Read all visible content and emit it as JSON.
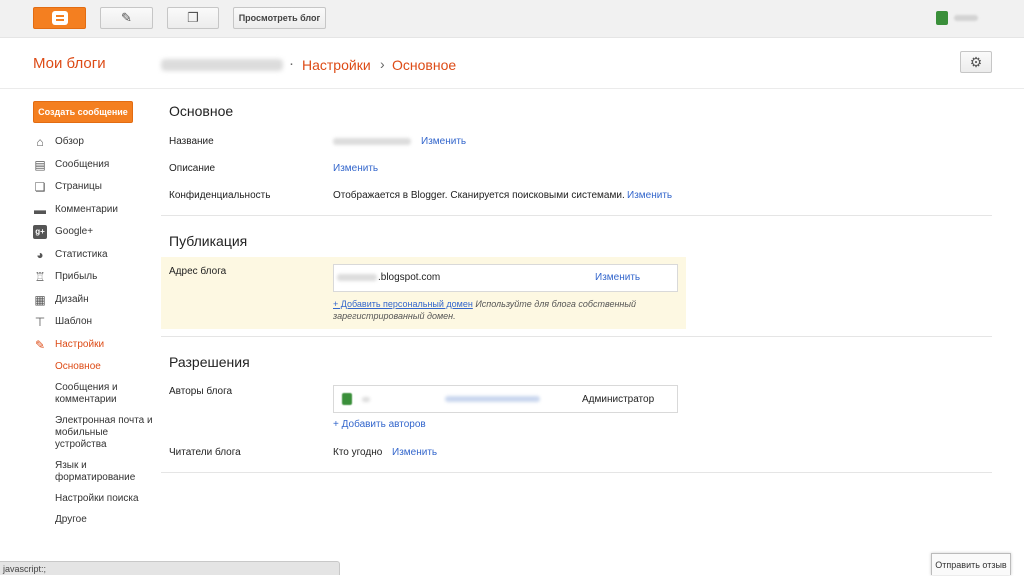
{
  "topbar": {
    "blogger_icon": "blogger-logo-icon",
    "edit_icon": "pencil-icon",
    "posts_icon": "posts-list-icon",
    "view_blog_label": "Просмотреть блог"
  },
  "header": {
    "my_blogs": "Мои блоги",
    "breadcrumb_sep_dot": "·",
    "breadcrumb_settings": "Настройки",
    "breadcrumb_arrow": "›",
    "breadcrumb_current": "Основное",
    "gear_icon": "gear-icon"
  },
  "sidebar": {
    "create_post": "Создать сообщение",
    "items": [
      {
        "label": "Обзор",
        "icon": "home-icon"
      },
      {
        "label": "Сообщения",
        "icon": "posts-icon"
      },
      {
        "label": "Страницы",
        "icon": "pages-icon"
      },
      {
        "label": "Комментарии",
        "icon": "comment-icon"
      },
      {
        "label": "Google+",
        "icon": "google-plus-icon"
      },
      {
        "label": "Статистика",
        "icon": "pie-chart-icon"
      },
      {
        "label": "Прибыль",
        "icon": "trophy-icon"
      },
      {
        "label": "Дизайн",
        "icon": "layout-icon"
      },
      {
        "label": "Шаблон",
        "icon": "paint-roller-icon"
      },
      {
        "label": "Настройки",
        "icon": "wrench-icon"
      }
    ],
    "subitems": [
      {
        "label": "Основное"
      },
      {
        "label": "Сообщения и комментарии"
      },
      {
        "label": "Электронная почта и мобильные устройства"
      },
      {
        "label": "Язык и форматирование"
      },
      {
        "label": "Настройки поиска"
      },
      {
        "label": "Другое"
      }
    ]
  },
  "main": {
    "basic": {
      "title": "Основное",
      "name_label": "Название",
      "name_change": "Изменить",
      "description_label": "Описание",
      "description_change": "Изменить",
      "privacy_label": "Конфиденциальность",
      "privacy_value": "Отображается в Blogger. Сканируется поисковыми системами.",
      "privacy_change": "Изменить"
    },
    "publishing": {
      "title": "Публикация",
      "address_label": "Адрес блога",
      "address_value": ".blogspot.com",
      "address_change": "Изменить",
      "add_domain_link": "+ Добавить персональный домен",
      "add_domain_note": " Используйте для блога собственный зарегистрированный домен."
    },
    "permissions": {
      "title": "Разрешения",
      "authors_label": "Авторы блога",
      "author_role": "Администратор",
      "add_authors": "+ Добавить авторов",
      "readers_label": "Читатели блога",
      "readers_value": "Кто угодно",
      "readers_change": "Изменить"
    }
  },
  "status_bar": "javascript:;",
  "feedback": "Отправить отзыв",
  "colors": {
    "accent": "#dd4b16",
    "button_orange": "#f47f20",
    "link": "#3366cc",
    "highlight": "#fdf8e2"
  }
}
